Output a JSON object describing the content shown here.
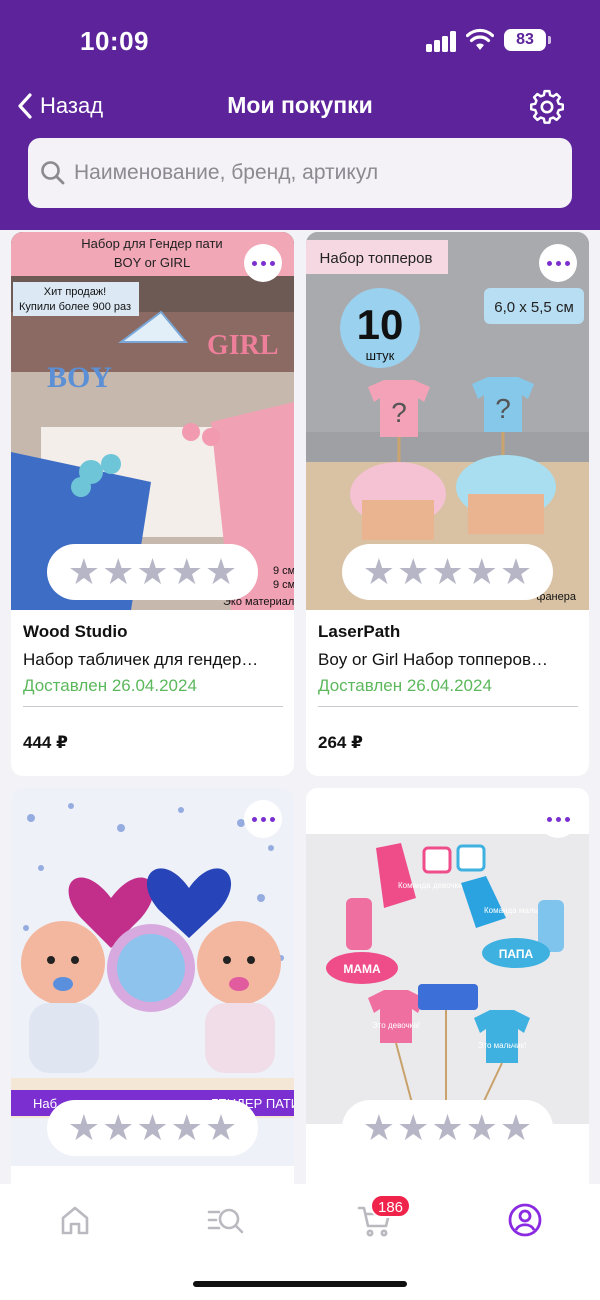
{
  "status_bar": {
    "time": "10:09",
    "battery": "83"
  },
  "nav": {
    "back_label": "Назад",
    "title": "Мои покупки"
  },
  "search": {
    "placeholder": "Наименование, бренд, артикул",
    "value": ""
  },
  "products": [
    {
      "brand": "Wood Studio",
      "title": "Набор табличек для гендер…",
      "status": "Доставлен 26.04.2024",
      "price": "444 ₽",
      "image_texts": [
        "Набор для Гендер пати",
        "BOY or GIRL",
        "Хит продаж!",
        "Купили более 900 раз",
        "BOY",
        "GIRL",
        "9 см",
        "9 см",
        "Эко материал"
      ]
    },
    {
      "brand": "LaserPath",
      "title": "Boy or Girl Набор топперов…",
      "status": "Доставлен 26.04.2024",
      "price": "264 ₽",
      "image_texts": [
        "Набор топперов",
        "6,0 х 5,5 см",
        "10",
        "штук",
        "?",
        "?",
        "фанера"
      ]
    },
    {
      "brand": "",
      "title": "",
      "status": "",
      "price": "",
      "image_texts": [
        "Наб",
        "ГЕНДЕР ПАТИ"
      ]
    },
    {
      "brand": "",
      "title": "",
      "status": "",
      "price": "",
      "image_texts": [
        "МАМА",
        "ПАПА",
        "Команда девочки",
        "Команда мальчики",
        "Это девочка!",
        "Это мальчик!"
      ]
    }
  ],
  "tabbar": {
    "items": [
      {
        "icon": "home-icon"
      },
      {
        "icon": "catalog-search-icon"
      },
      {
        "icon": "cart-icon",
        "badge": "186"
      },
      {
        "icon": "profile-icon",
        "active": true
      }
    ]
  },
  "colors": {
    "header_bg": "#5c239b",
    "accent": "#7b2fd0",
    "delivered": "#5cb85c",
    "badge": "#f0234b"
  },
  "rating": {
    "stars": 5,
    "filled": 0
  }
}
